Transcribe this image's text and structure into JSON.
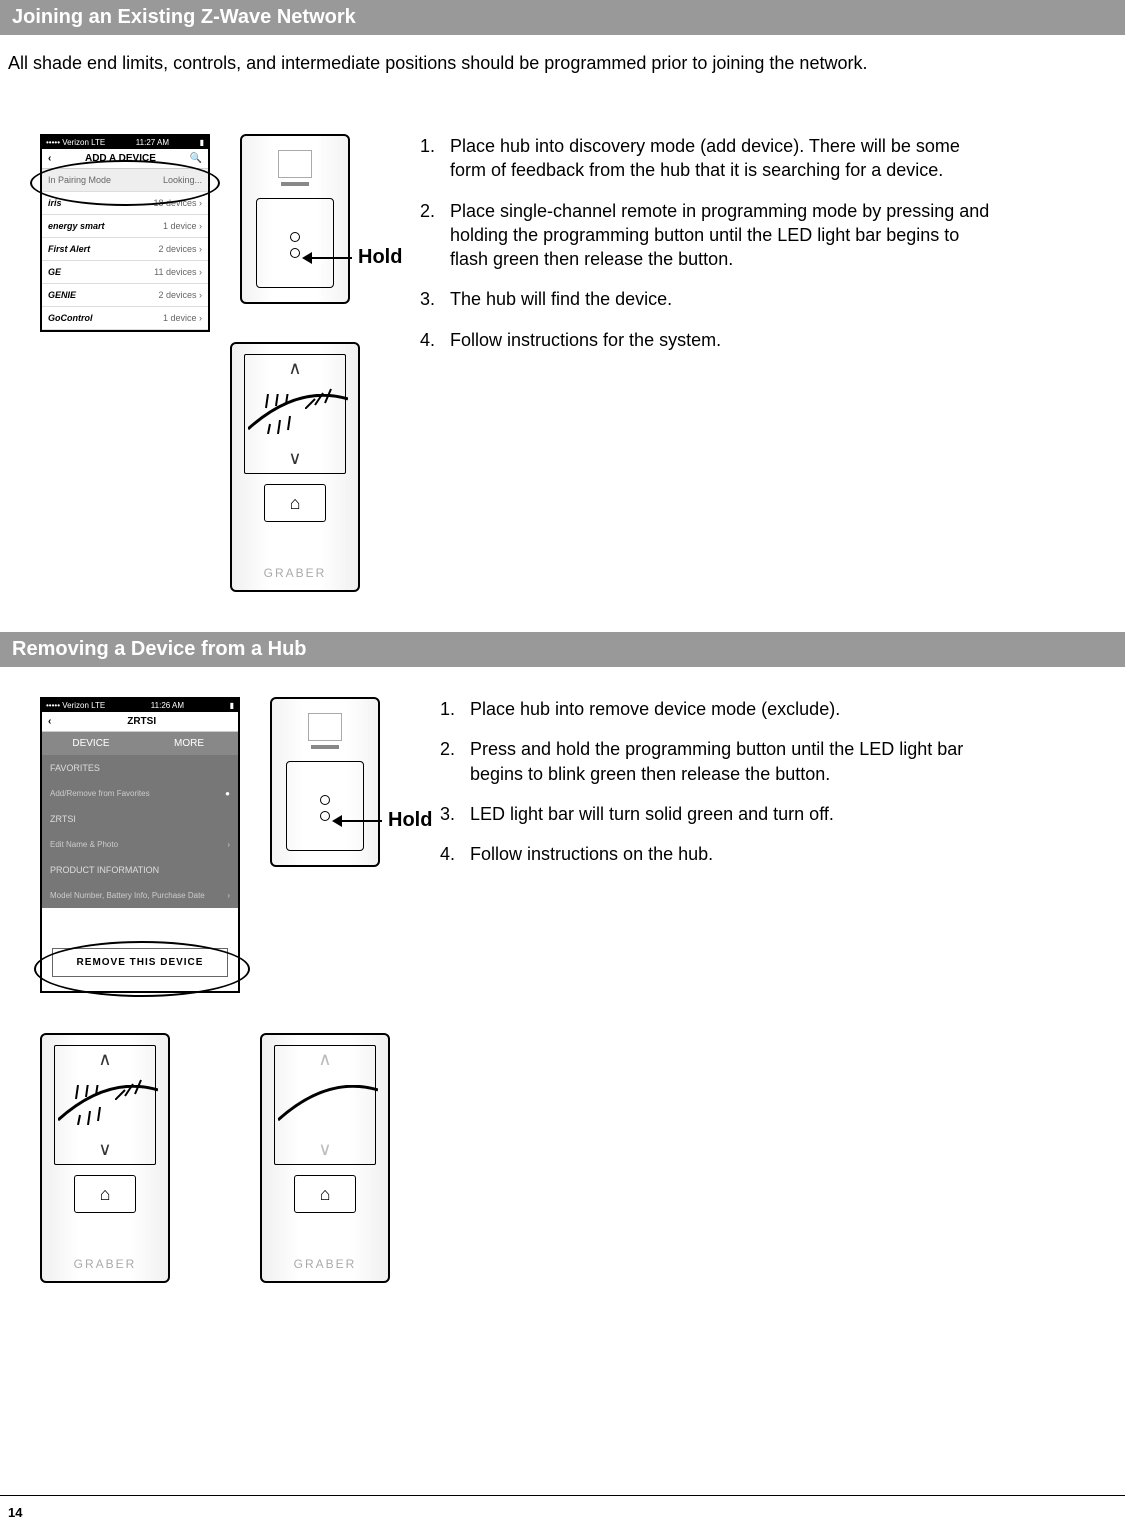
{
  "section1": {
    "title": "Joining an Existing Z-Wave Network",
    "intro": "All shade end limits, controls, and intermediate positions should be programmed prior to joining the network.",
    "hold_label": "Hold",
    "remote_brand": "GRABER",
    "phone": {
      "carrier": "••••• Verizon  LTE",
      "time": "11:27 AM",
      "title": "ADD A DEVICE",
      "pairing": "In Pairing Mode",
      "looking": "Looking...",
      "rows": [
        {
          "brand": "iris",
          "count": "18 devices"
        },
        {
          "brand": "energy smart",
          "count": "1 device"
        },
        {
          "brand": "First Alert",
          "count": "2 devices"
        },
        {
          "brand": "GE",
          "count": "11 devices"
        },
        {
          "brand": "GENIE",
          "count": "2 devices"
        },
        {
          "brand": "GoControl",
          "count": "1 device"
        }
      ]
    },
    "steps": [
      "Place hub into discovery mode (add device). There will be some form of feedback from the hub that it is searching for a device.",
      "Place single-channel remote in programming mode by pressing and holding the programming button until the LED light bar begins to flash green then release the button.",
      "The hub will find the device.",
      "Follow instructions for the system."
    ]
  },
  "section2": {
    "title": "Removing a Device from a Hub",
    "hold_label": "Hold",
    "remote_brand": "GRABER",
    "phone": {
      "carrier": "••••• Verizon  LTE",
      "time": "11:26 AM",
      "title": "ZRTSI",
      "tab1": "DEVICE",
      "tab2": "MORE",
      "fav_label": "FAVORITES",
      "fav_sub": "Add/Remove from Favorites",
      "zrtsi_label": "ZRTSI",
      "zrtsi_sub": "Edit Name & Photo",
      "prod_label": "PRODUCT INFORMATION",
      "prod_sub": "Model Number, Battery Info, Purchase Date",
      "remove_btn": "REMOVE THIS DEVICE"
    },
    "steps": [
      "Place hub into remove device mode (exclude).",
      "Press and hold the programming button until the LED light bar begins to blink green then release the button.",
      "LED light bar will turn solid green and turn off.",
      "Follow instructions on the hub."
    ]
  },
  "page_number": "14"
}
